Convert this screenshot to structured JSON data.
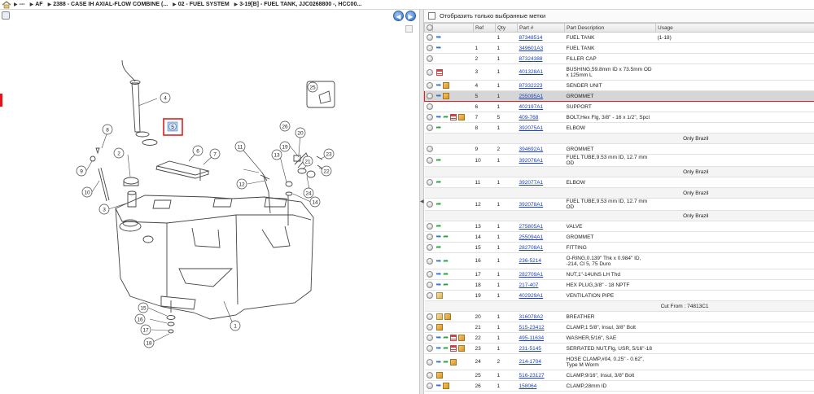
{
  "breadcrumb": {
    "items": [
      "---",
      "AF",
      "2388 - CASE IH AXIAL-FLOW COMBINE (...",
      "02 - FUEL SYSTEM",
      "3-19[B] - FUEL TANK, JJC0268800 -, HCC00..."
    ]
  },
  "filter": {
    "label": "Отобразить только выбранные метки"
  },
  "table": {
    "headers": [
      "",
      "",
      "Ref",
      "Qty",
      "Part #",
      "Part Description",
      "Usage"
    ],
    "rows": [
      {
        "kind": "part",
        "icons": [
          "blue-arrow"
        ],
        "ref": "",
        "qty": "1",
        "part": "87348514",
        "desc": "FUEL TANK",
        "usage": "(1-18)"
      },
      {
        "kind": "part",
        "icons": [
          "blue-arrow"
        ],
        "ref": "1",
        "qty": "1",
        "part": "349601A3",
        "desc": "FUEL TANK",
        "usage": ""
      },
      {
        "kind": "part",
        "icons": [],
        "ref": "2",
        "qty": "1",
        "part": "87324388",
        "desc": "FILLER CAP",
        "usage": ""
      },
      {
        "kind": "part",
        "tall": true,
        "icons": [
          "doc"
        ],
        "ref": "3",
        "qty": "1",
        "part": "401328A1",
        "desc": "BUSHING,59.8mm ID x 73.5mm OD x 125mm L",
        "usage": ""
      },
      {
        "kind": "part",
        "icons": [
          "blue-arrow",
          "box"
        ],
        "ref": "4",
        "qty": "1",
        "part": "87332223",
        "desc": "SENDER UNIT",
        "usage": ""
      },
      {
        "kind": "part",
        "selected": true,
        "icons": [
          "blue-arrow",
          "box"
        ],
        "ref": "5",
        "qty": "1",
        "part": "255095A1",
        "desc": "GROMMET",
        "usage": ""
      },
      {
        "kind": "part",
        "icons": [],
        "ref": "6",
        "qty": "1",
        "part": "402197A1",
        "desc": "SUPPORT",
        "usage": ""
      },
      {
        "kind": "part",
        "icons": [
          "blue-arrow",
          "green-arrow",
          "doc",
          "box"
        ],
        "ref": "7",
        "qty": "5",
        "part": "409-768",
        "desc": "BOLT,Hex Flg, 3/8\" - 16 x 1/2\", Spcl",
        "usage": ""
      },
      {
        "kind": "part",
        "icons": [
          "green-arrow"
        ],
        "ref": "8",
        "qty": "1",
        "part": "392075A1",
        "desc": "ELBOW",
        "usage": ""
      },
      {
        "kind": "note",
        "text": "Only Brazil"
      },
      {
        "kind": "part",
        "icons": [],
        "ref": "9",
        "qty": "2",
        "part": "394692A1",
        "desc": "GROMMET",
        "usage": ""
      },
      {
        "kind": "part",
        "icons": [
          "green-arrow"
        ],
        "ref": "10",
        "qty": "1",
        "part": "392076A1",
        "desc": "FUEL TUBE,9.53 mm ID, 12.7 mm OD",
        "usage": ""
      },
      {
        "kind": "note",
        "text": "Only Brazil"
      },
      {
        "kind": "part",
        "icons": [
          "green-arrow"
        ],
        "ref": "11",
        "qty": "1",
        "part": "392077A1",
        "desc": "ELBOW",
        "usage": ""
      },
      {
        "kind": "note",
        "text": "Only Brazil"
      },
      {
        "kind": "part",
        "icons": [
          "green-arrow"
        ],
        "ref": "12",
        "qty": "1",
        "part": "392078A1",
        "desc": "FUEL TUBE,9.53 mm ID, 12.7 mm OD",
        "usage": ""
      },
      {
        "kind": "note",
        "text": "Only Brazil"
      },
      {
        "kind": "part",
        "icons": [
          "green-arrow"
        ],
        "ref": "13",
        "qty": "1",
        "part": "275805A1",
        "desc": "VALVE",
        "usage": ""
      },
      {
        "kind": "part",
        "icons": [
          "blue-arrow",
          "green-arrow"
        ],
        "ref": "14",
        "qty": "1",
        "part": "255094A1",
        "desc": "GROMMET",
        "usage": ""
      },
      {
        "kind": "part",
        "icons": [
          "green-arrow"
        ],
        "ref": "15",
        "qty": "1",
        "part": "282708A1",
        "desc": "FITTING",
        "usage": ""
      },
      {
        "kind": "part",
        "tall": true,
        "icons": [
          "blue-arrow",
          "green-arrow"
        ],
        "ref": "16",
        "qty": "1",
        "part": "236-5214",
        "desc": "O-RING,0.139\" Thk x 0.984\" ID, -214, Cl 5, 75 Duro",
        "usage": ""
      },
      {
        "kind": "part",
        "icons": [
          "blue-arrow",
          "green-arrow"
        ],
        "ref": "17",
        "qty": "1",
        "part": "282709A1",
        "desc": "NUT,1\"-14UNS LH Thd",
        "usage": ""
      },
      {
        "kind": "part",
        "icons": [
          "blue-arrow",
          "green-arrow"
        ],
        "ref": "18",
        "qty": "1",
        "part": "217-407",
        "desc": "HEX PLUG,3/8\" - 18 NPTF",
        "usage": ""
      },
      {
        "kind": "part",
        "icons": [
          "box2"
        ],
        "ref": "19",
        "qty": "1",
        "part": "402929A1",
        "desc": "VENTILATION PIPE",
        "usage": ""
      },
      {
        "kind": "note",
        "text": "Cut From : 74813C1"
      },
      {
        "kind": "part",
        "icons": [
          "box2",
          "box"
        ],
        "ref": "20",
        "qty": "1",
        "part": "316078A2",
        "desc": "BREATHER",
        "usage": ""
      },
      {
        "kind": "part",
        "icons": [
          "box"
        ],
        "ref": "21",
        "qty": "1",
        "part": "515-23412",
        "desc": "CLAMP,1 5/8\", Insul, 3/8\" Bolt",
        "usage": ""
      },
      {
        "kind": "part",
        "icons": [
          "blue-arrow",
          "green-arrow",
          "doc",
          "box"
        ],
        "ref": "22",
        "qty": "1",
        "part": "495-11634",
        "desc": "WASHER,5/16\", SAE",
        "usage": ""
      },
      {
        "kind": "part",
        "icons": [
          "blue-arrow",
          "green-arrow",
          "doc",
          "box"
        ],
        "ref": "23",
        "qty": "1",
        "part": "231-5145",
        "desc": "SERRATED NUT,Flg, USR, 5/16\"-18",
        "usage": ""
      },
      {
        "kind": "part",
        "tall": true,
        "icons": [
          "blue-arrow",
          "green-arrow",
          "box"
        ],
        "ref": "24",
        "qty": "2",
        "part": "214-1704",
        "desc": "HOSE CLAMP,#04, 0.25\" - 0.62\", Type M Worm",
        "usage": ""
      },
      {
        "kind": "part",
        "icons": [
          "box"
        ],
        "ref": "25",
        "qty": "1",
        "part": "516-23127",
        "desc": "CLAMP,9/16\", Insul, 3/8\" Bolt",
        "usage": ""
      },
      {
        "kind": "part",
        "icons": [
          "blue-arrow",
          "box"
        ],
        "ref": "26",
        "qty": "1",
        "part": "158064",
        "desc": "CLAMP,28mm ID",
        "usage": ""
      }
    ]
  },
  "diagram": {
    "callouts": [
      "1",
      "2",
      "3",
      "4",
      "5",
      "6",
      "7",
      "8",
      "9",
      "10",
      "11",
      "12",
      "13",
      "14",
      "15",
      "16",
      "17",
      "18",
      "19",
      "20",
      "21",
      "22",
      "23",
      "24",
      "25",
      "26"
    ],
    "highlighted": "5"
  }
}
